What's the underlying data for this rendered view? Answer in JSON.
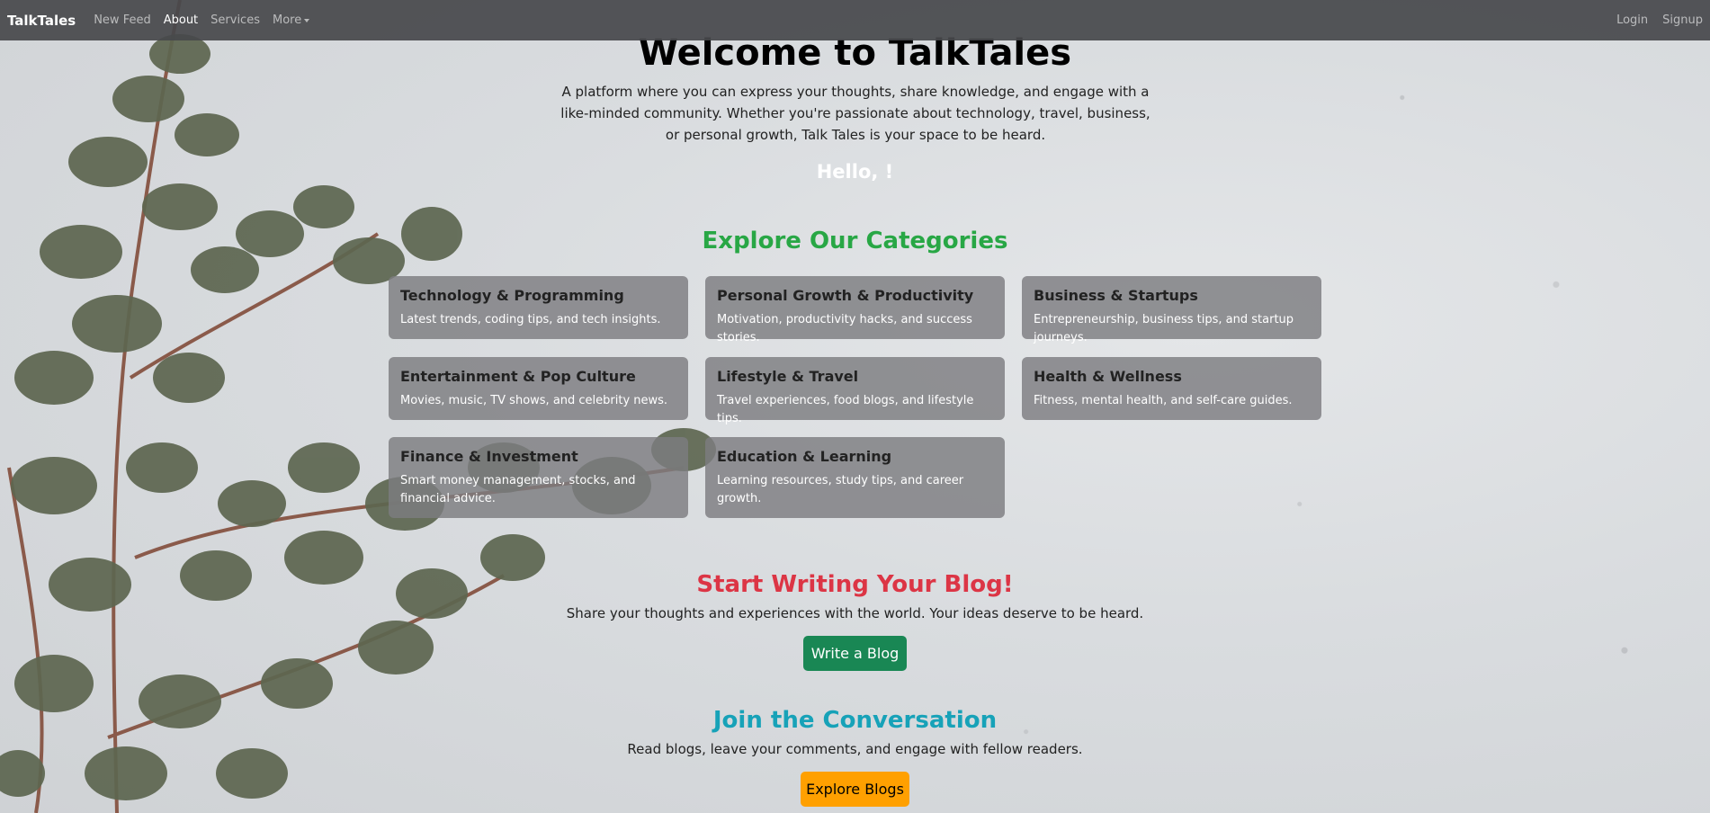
{
  "navbar": {
    "brand": "TalkTales",
    "links": [
      "New Feed",
      "About",
      "Services",
      "More"
    ],
    "right_links": [
      "Login",
      "Signup"
    ]
  },
  "hero": {
    "title": "Welcome to TalkTales",
    "description": "A platform where you can express your thoughts, share knowledge, and engage with a like-minded community. Whether you're passionate about technology, travel, business, or personal growth, Talk Tales is your space to be heard.",
    "greeting": "Hello, !"
  },
  "categories": {
    "title": "Explore Our Categories",
    "items": [
      {
        "title": "Technology & Programming",
        "desc": "Latest trends, coding tips, and tech insights."
      },
      {
        "title": "Personal Growth & Productivity",
        "desc": "Motivation, productivity hacks, and success stories."
      },
      {
        "title": "Business & Startups",
        "desc": "Entrepreneurship, business tips, and startup journeys."
      },
      {
        "title": "Entertainment & Pop Culture",
        "desc": "Movies, music, TV shows, and celebrity news."
      },
      {
        "title": "Lifestyle & Travel",
        "desc": "Travel experiences, food blogs, and lifestyle tips."
      },
      {
        "title": "Health & Wellness",
        "desc": "Fitness, mental health, and self-care guides."
      },
      {
        "title": "Finance & Investment",
        "desc": "Smart money management, stocks, and financial advice."
      },
      {
        "title": "Education & Learning",
        "desc": "Learning resources, study tips, and career growth."
      }
    ]
  },
  "write": {
    "title": "Start Writing Your Blog!",
    "description": "Share your thoughts and experiences with the world. Your ideas deserve to be heard.",
    "button": "Write a Blog"
  },
  "join": {
    "title": "Join the Conversation",
    "description": "Read blogs, leave your comments, and engage with fellow readers.",
    "button": "Explore Blogs"
  },
  "colors": {
    "navbar_bg": "#46484b",
    "categories_title": "#28a745",
    "write_title": "#dc3545",
    "join_title": "#17a2b8",
    "write_button": "#198754",
    "explore_button": "#ffa000"
  }
}
